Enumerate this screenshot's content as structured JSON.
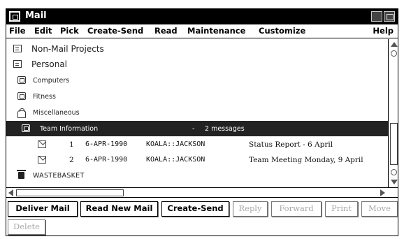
{
  "window": {
    "title": "Mail"
  },
  "menu": {
    "items": [
      "File",
      "Edit",
      "Pick",
      "Create-Send",
      "Read",
      "Maintenance",
      "Customize"
    ],
    "help": "Help"
  },
  "tree": {
    "non_mail": "Non-Mail Projects",
    "personal": "Personal",
    "computers": "Computers",
    "fitness": "Fitness",
    "misc": "Miscellaneous",
    "team": "Team Information",
    "team_count": "2 messages",
    "wastebasket": "WASTEBASKET"
  },
  "messages": [
    {
      "num": "1",
      "date": "6-APR-1990",
      "from": "KOALA::JACKSON",
      "subject": "Status Report - 6 April"
    },
    {
      "num": "2",
      "date": "6-APR-1990",
      "from": "KOALA::JACKSON",
      "subject": "Team Meeting Monday, 9 April"
    }
  ],
  "buttons": {
    "deliver": "Deliver Mail",
    "read_new": "Read New Mail",
    "create_send": "Create-Send",
    "reply": "Reply",
    "forward": "Forward",
    "print": "Print",
    "move": "Move",
    "delete": "Delete"
  },
  "icons": {
    "app": "mail-app-icon",
    "folder_box": "folder-box-icon",
    "folder_open": "folder-open-icon",
    "bag": "bag-icon",
    "envelope": "envelope-icon",
    "trash": "trash-icon"
  }
}
